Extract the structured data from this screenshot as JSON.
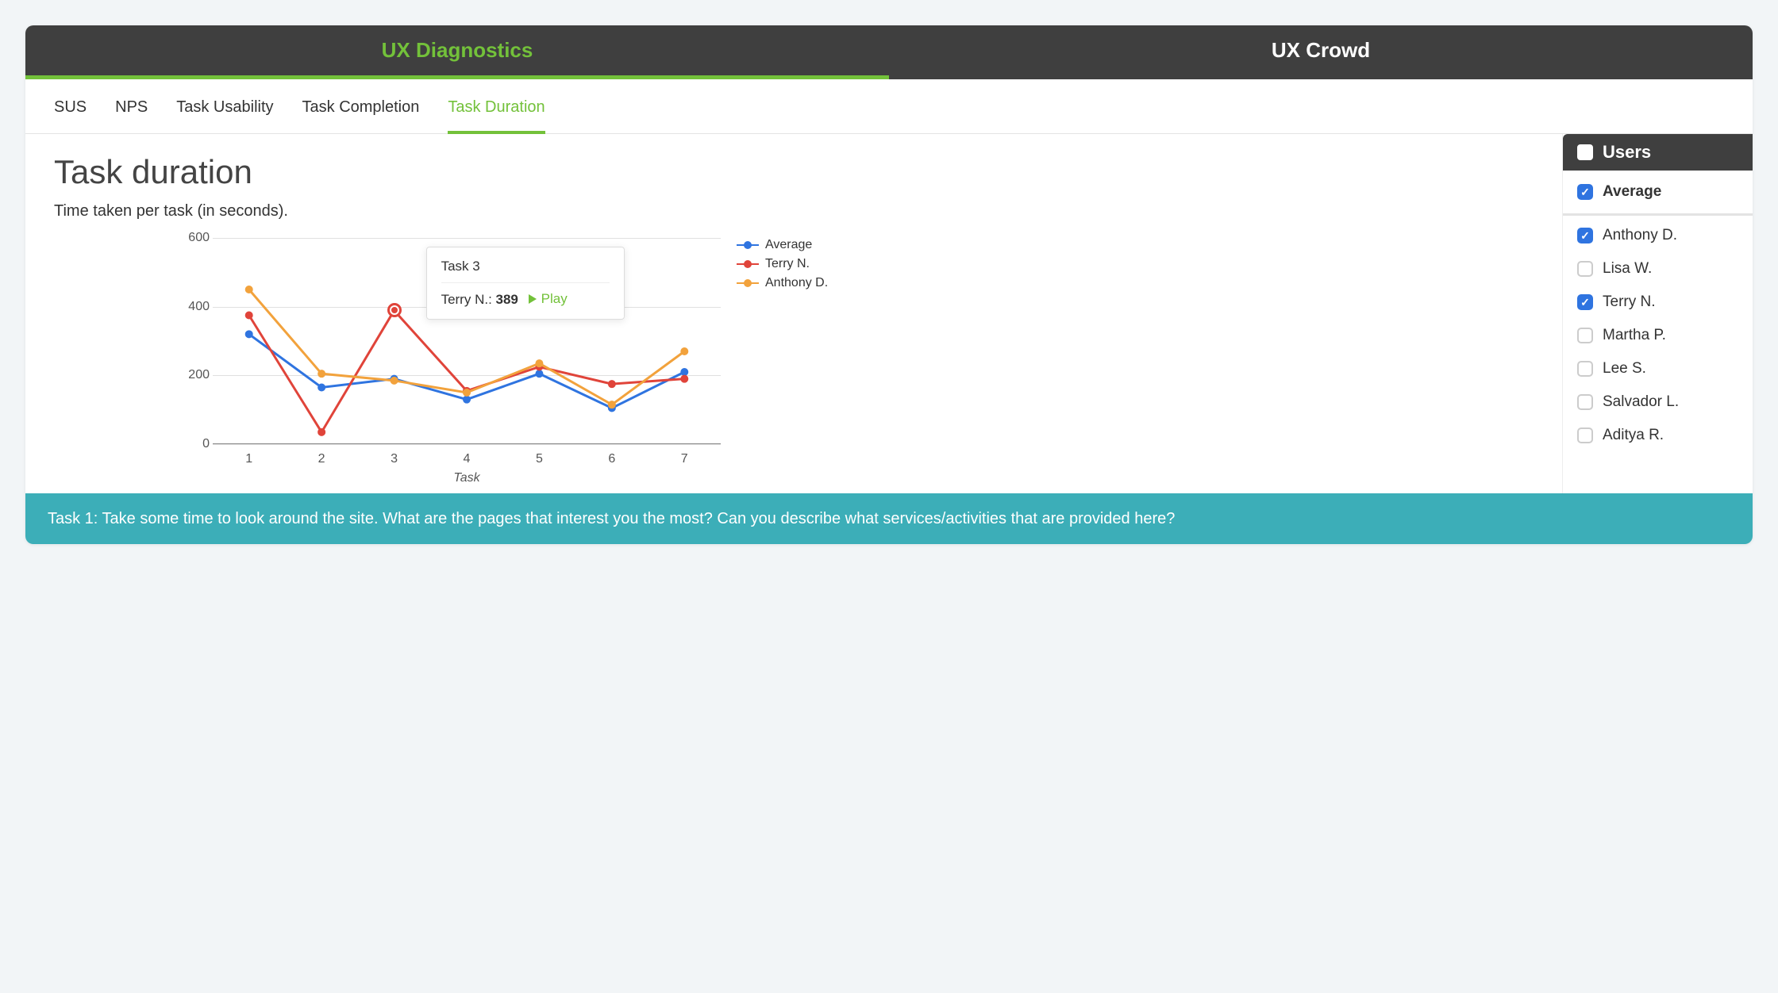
{
  "top_tabs": [
    {
      "label": "UX Diagnostics",
      "active": true
    },
    {
      "label": "UX Crowd",
      "active": false
    }
  ],
  "sub_tabs": [
    {
      "label": "SUS",
      "active": false
    },
    {
      "label": "NPS",
      "active": false
    },
    {
      "label": "Task Usability",
      "active": false
    },
    {
      "label": "Task Completion",
      "active": false
    },
    {
      "label": "Task Duration",
      "active": true
    }
  ],
  "page": {
    "title": "Task duration",
    "subtitle": "Time taken per task (in seconds)."
  },
  "chart_data": {
    "type": "line",
    "xlabel": "Task",
    "ylabel": "",
    "ylim": [
      0,
      600
    ],
    "y_ticks": [
      0,
      200,
      400,
      600
    ],
    "categories": [
      "1",
      "2",
      "3",
      "4",
      "5",
      "6",
      "7"
    ],
    "series": [
      {
        "name": "Average",
        "color": "#2f74e0",
        "values": [
          320,
          165,
          190,
          130,
          205,
          105,
          210
        ]
      },
      {
        "name": "Terry N.",
        "color": "#e0443a",
        "values": [
          375,
          35,
          389,
          155,
          225,
          175,
          190
        ]
      },
      {
        "name": "Anthony D.",
        "color": "#f2a23c",
        "values": [
          450,
          205,
          185,
          150,
          235,
          115,
          270
        ]
      }
    ],
    "highlight": {
      "series": "Terry N.",
      "category": "3"
    }
  },
  "tooltip": {
    "title": "Task 3",
    "user": "Terry N.",
    "value": "389",
    "action": "Play"
  },
  "users_panel": {
    "title": "Users",
    "average_label": "Average",
    "average_checked": true,
    "users": [
      {
        "name": "Anthony D.",
        "checked": true
      },
      {
        "name": "Lisa W.",
        "checked": false
      },
      {
        "name": "Terry N.",
        "checked": true
      },
      {
        "name": "Martha P.",
        "checked": false
      },
      {
        "name": "Lee S.",
        "checked": false
      },
      {
        "name": "Salvador L.",
        "checked": false
      },
      {
        "name": "Aditya R.",
        "checked": false
      }
    ]
  },
  "task_banner": "Task 1: Take some time to look around the site. What are the pages that interest you the most? Can you describe what services/activities that are provided here?"
}
